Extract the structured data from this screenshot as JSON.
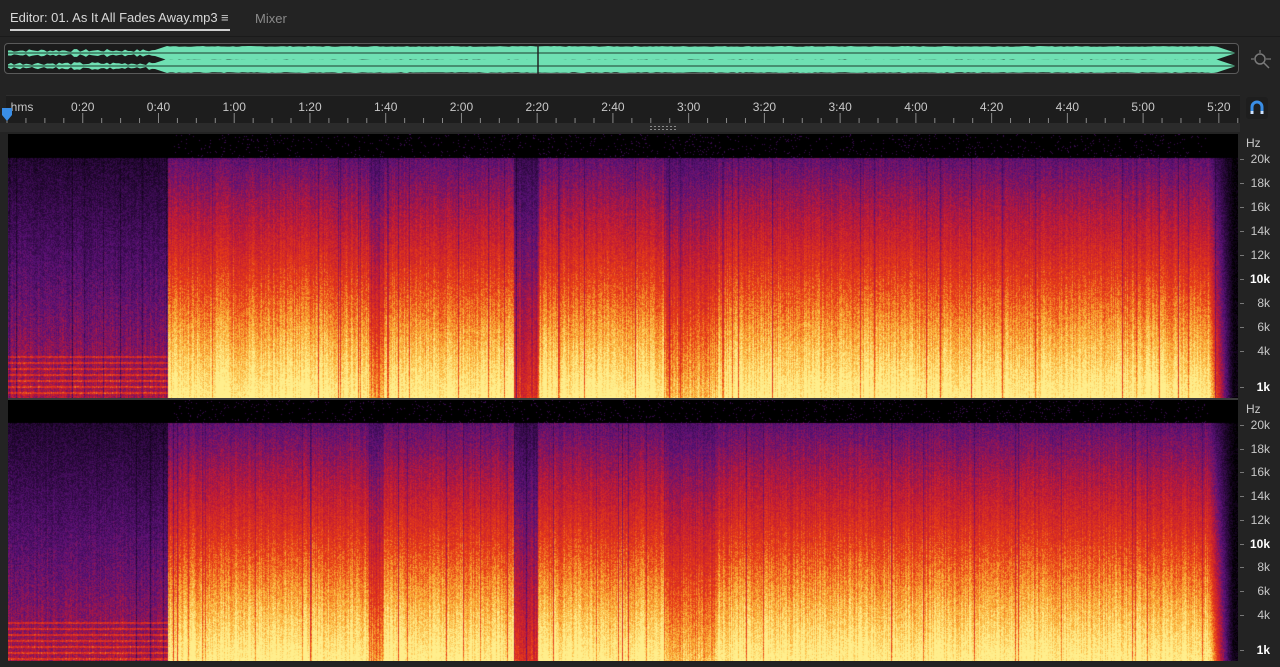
{
  "tabs": {
    "editor_label": "Editor: 01. As It All Fades Away.mp3",
    "menu_glyph": "≡",
    "mixer_label": "Mixer"
  },
  "overview": {
    "icon": "zoom-navigator-icon",
    "waveform_color": "#6fe0b3"
  },
  "timeline": {
    "unit": "hms",
    "labels": [
      "0:20",
      "0:40",
      "1:00",
      "1:20",
      "1:40",
      "2:00",
      "2:20",
      "2:40",
      "3:00",
      "3:20",
      "3:40",
      "4:00",
      "4:20",
      "4:40",
      "5:00",
      "5:20"
    ],
    "snap_icon": "magnet-icon",
    "playhead_color": "#3a8ee6"
  },
  "frequency_scale": {
    "unit": "Hz",
    "labels": [
      "20k",
      "18k",
      "16k",
      "14k",
      "12k",
      "10k",
      "8k",
      "6k",
      "4k",
      "1k"
    ]
  },
  "colors": {
    "background": "#232323",
    "accent": "#3a8ee6",
    "spectrum_low": "#2a0a40",
    "spectrum_mid": "#d81e1e",
    "spectrum_high": "#ffe27a"
  }
}
